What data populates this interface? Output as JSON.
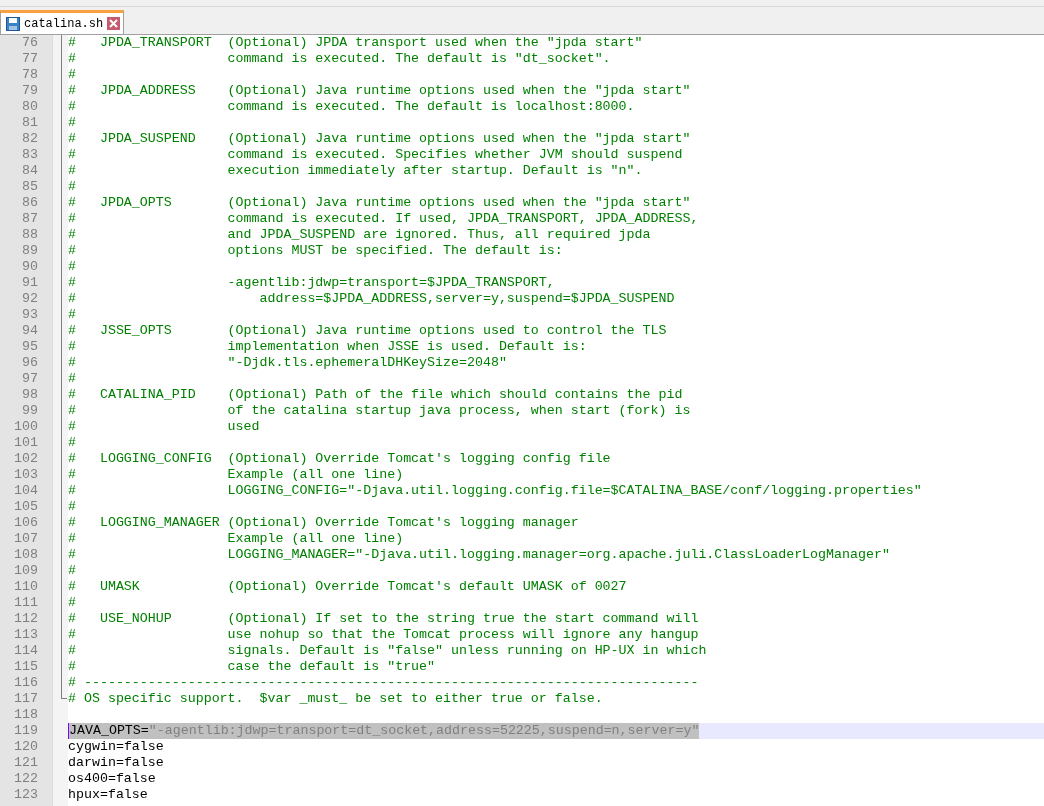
{
  "tabs": [
    {
      "label": "catalina.sh",
      "selected": true
    }
  ],
  "editor": {
    "lines": [
      {
        "number": "76",
        "kind": "comment",
        "selected": false,
        "text": "#   JPDA_TRANSPORT  (Optional) JPDA transport used when the \"jpda start\""
      },
      {
        "number": "77",
        "kind": "comment",
        "selected": false,
        "text": "#                   command is executed. The default is \"dt_socket\"."
      },
      {
        "number": "78",
        "kind": "comment",
        "selected": false,
        "text": "#"
      },
      {
        "number": "79",
        "kind": "comment",
        "selected": false,
        "text": "#   JPDA_ADDRESS    (Optional) Java runtime options used when the \"jpda start\""
      },
      {
        "number": "80",
        "kind": "comment",
        "selected": false,
        "text": "#                   command is executed. The default is localhost:8000."
      },
      {
        "number": "81",
        "kind": "comment",
        "selected": false,
        "text": "#"
      },
      {
        "number": "82",
        "kind": "comment",
        "selected": false,
        "text": "#   JPDA_SUSPEND    (Optional) Java runtime options used when the \"jpda start\""
      },
      {
        "number": "83",
        "kind": "comment",
        "selected": false,
        "text": "#                   command is executed. Specifies whether JVM should suspend"
      },
      {
        "number": "84",
        "kind": "comment",
        "selected": false,
        "text": "#                   execution immediately after startup. Default is \"n\"."
      },
      {
        "number": "85",
        "kind": "comment",
        "selected": false,
        "text": "#"
      },
      {
        "number": "86",
        "kind": "comment",
        "selected": false,
        "text": "#   JPDA_OPTS       (Optional) Java runtime options used when the \"jpda start\""
      },
      {
        "number": "87",
        "kind": "comment",
        "selected": false,
        "text": "#                   command is executed. If used, JPDA_TRANSPORT, JPDA_ADDRESS,"
      },
      {
        "number": "88",
        "kind": "comment",
        "selected": false,
        "text": "#                   and JPDA_SUSPEND are ignored. Thus, all required jpda"
      },
      {
        "number": "89",
        "kind": "comment",
        "selected": false,
        "text": "#                   options MUST be specified. The default is:"
      },
      {
        "number": "90",
        "kind": "comment",
        "selected": false,
        "text": "#"
      },
      {
        "number": "91",
        "kind": "comment",
        "selected": false,
        "text": "#                   -agentlib:jdwp=transport=$JPDA_TRANSPORT,"
      },
      {
        "number": "92",
        "kind": "comment",
        "selected": false,
        "text": "#                       address=$JPDA_ADDRESS,server=y,suspend=$JPDA_SUSPEND"
      },
      {
        "number": "93",
        "kind": "comment",
        "selected": false,
        "text": "#"
      },
      {
        "number": "94",
        "kind": "comment",
        "selected": false,
        "text": "#   JSSE_OPTS       (Optional) Java runtime options used to control the TLS"
      },
      {
        "number": "95",
        "kind": "comment",
        "selected": false,
        "text": "#                   implementation when JSSE is used. Default is:"
      },
      {
        "number": "96",
        "kind": "comment",
        "selected": false,
        "text": "#                   \"-Djdk.tls.ephemeralDHKeySize=2048\""
      },
      {
        "number": "97",
        "kind": "comment",
        "selected": false,
        "text": "#"
      },
      {
        "number": "98",
        "kind": "comment",
        "selected": false,
        "text": "#   CATALINA_PID    (Optional) Path of the file which should contains the pid"
      },
      {
        "number": "99",
        "kind": "comment",
        "selected": false,
        "text": "#                   of the catalina startup java process, when start (fork) is"
      },
      {
        "number": "100",
        "kind": "comment",
        "selected": false,
        "text": "#                   used"
      },
      {
        "number": "101",
        "kind": "comment",
        "selected": false,
        "text": "#"
      },
      {
        "number": "102",
        "kind": "comment",
        "selected": false,
        "text": "#   LOGGING_CONFIG  (Optional) Override Tomcat's logging config file"
      },
      {
        "number": "103",
        "kind": "comment",
        "selected": false,
        "text": "#                   Example (all one line)"
      },
      {
        "number": "104",
        "kind": "comment",
        "selected": false,
        "text": "#                   LOGGING_CONFIG=\"-Djava.util.logging.config.file=$CATALINA_BASE/conf/logging.properties\""
      },
      {
        "number": "105",
        "kind": "comment",
        "selected": false,
        "text": "#"
      },
      {
        "number": "106",
        "kind": "comment",
        "selected": false,
        "text": "#   LOGGING_MANAGER (Optional) Override Tomcat's logging manager"
      },
      {
        "number": "107",
        "kind": "comment",
        "selected": false,
        "text": "#                   Example (all one line)"
      },
      {
        "number": "108",
        "kind": "comment",
        "selected": false,
        "text": "#                   LOGGING_MANAGER=\"-Djava.util.logging.manager=org.apache.juli.ClassLoaderLogManager\""
      },
      {
        "number": "109",
        "kind": "comment",
        "selected": false,
        "text": "#"
      },
      {
        "number": "110",
        "kind": "comment",
        "selected": false,
        "text": "#   UMASK           (Optional) Override Tomcat's default UMASK of 0027"
      },
      {
        "number": "111",
        "kind": "comment",
        "selected": false,
        "text": "#"
      },
      {
        "number": "112",
        "kind": "comment",
        "selected": false,
        "text": "#   USE_NOHUP       (Optional) If set to the string true the start command will"
      },
      {
        "number": "113",
        "kind": "comment",
        "selected": false,
        "text": "#                   use nohup so that the Tomcat process will ignore any hangup"
      },
      {
        "number": "114",
        "kind": "comment",
        "selected": false,
        "text": "#                   signals. Default is \"false\" unless running on HP-UX in which"
      },
      {
        "number": "115",
        "kind": "comment",
        "selected": false,
        "text": "#                   case the default is \"true\""
      },
      {
        "number": "116",
        "kind": "comment",
        "selected": false,
        "text": "# -----------------------------------------------------------------------------"
      },
      {
        "number": "117",
        "kind": "comment",
        "selected": false,
        "text": "# OS specific support.  $var _must_ be set to either true or false."
      },
      {
        "number": "118",
        "kind": "blank",
        "selected": false
      },
      {
        "number": "119",
        "kind": "code",
        "selected": true,
        "tokens": [
          {
            "kind": "ident",
            "text": "JAVA_OPTS"
          },
          {
            "kind": "op",
            "text": "="
          },
          {
            "kind": "string",
            "text": "\"-agentlib:jdwp=transport=dt_socket,address=52225,suspend=n,server=y\""
          }
        ]
      },
      {
        "number": "120",
        "kind": "code",
        "selected": false,
        "tokens": [
          {
            "kind": "ident",
            "text": "cygwin"
          },
          {
            "kind": "op",
            "text": "="
          },
          {
            "kind": "ident",
            "text": "false"
          }
        ]
      },
      {
        "number": "121",
        "kind": "code",
        "selected": false,
        "tokens": [
          {
            "kind": "ident",
            "text": "darwin"
          },
          {
            "kind": "op",
            "text": "="
          },
          {
            "kind": "ident",
            "text": "false"
          }
        ]
      },
      {
        "number": "122",
        "kind": "code",
        "selected": false,
        "tokens": [
          {
            "kind": "ident",
            "text": "os400"
          },
          {
            "kind": "op",
            "text": "="
          },
          {
            "kind": "ident",
            "text": "false"
          }
        ]
      },
      {
        "number": "123",
        "kind": "code",
        "selected": false,
        "tokens": [
          {
            "kind": "ident",
            "text": "hpux"
          },
          {
            "kind": "op",
            "text": "="
          },
          {
            "kind": "ident",
            "text": "false"
          }
        ]
      }
    ]
  }
}
